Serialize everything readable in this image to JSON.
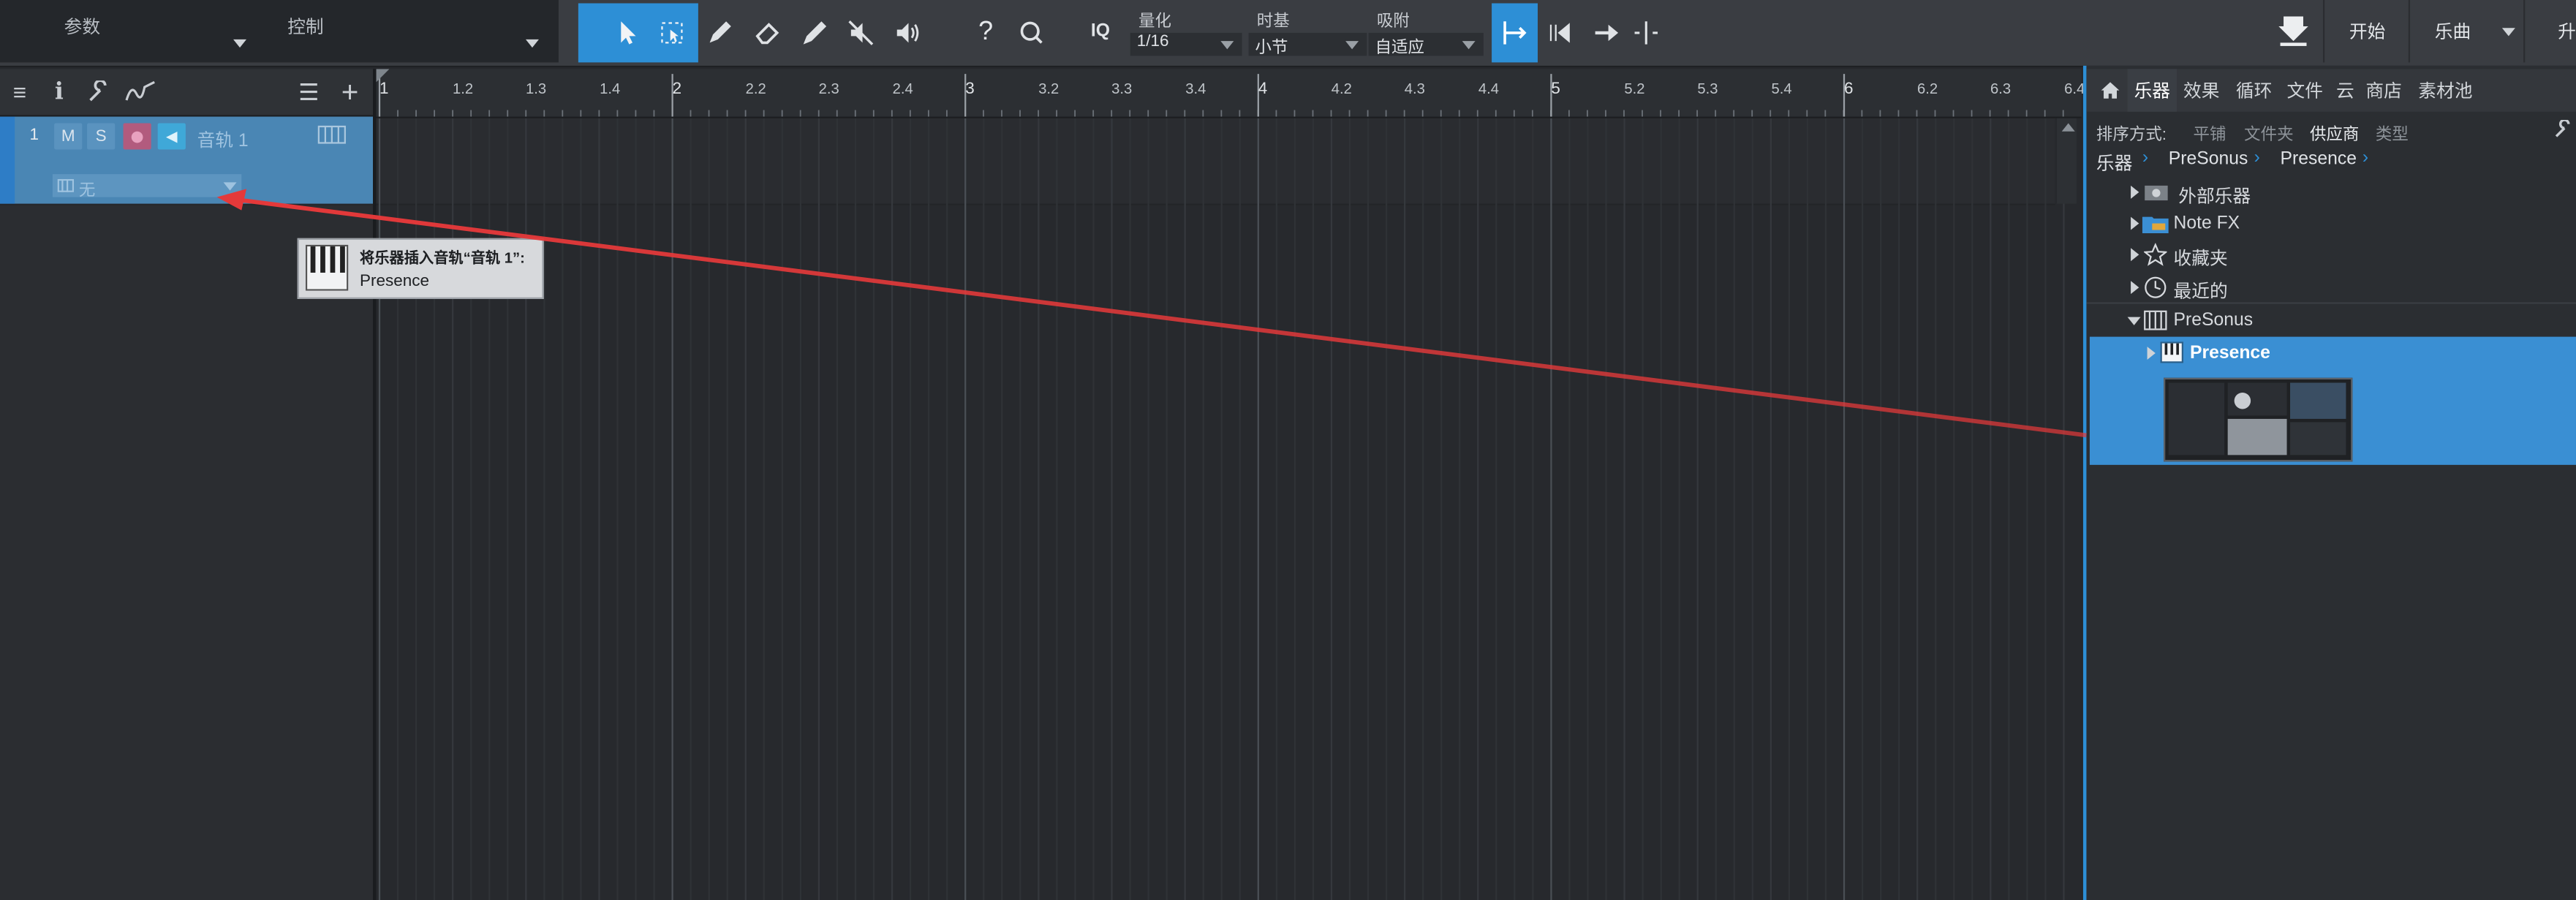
{
  "toolbar": {
    "params_label": "参数",
    "control_label": "控制",
    "iq_label": "IQ",
    "quantize": {
      "label": "量化",
      "value": "1/16"
    },
    "timebase": {
      "label": "时基",
      "value": "小节"
    },
    "snap": {
      "label": "吸附",
      "value": "自适应"
    },
    "help_glyph": "?",
    "right_buttons": [
      "开始",
      "乐曲",
      "升"
    ]
  },
  "track": {
    "number": "1",
    "mute": "M",
    "solo": "S",
    "name": "音轨 1",
    "instrument": "无"
  },
  "ruler": {
    "labels": [
      "1",
      "1.2",
      "1.3",
      "1.4",
      "2",
      "2.2",
      "2.3",
      "2.4",
      "3",
      "3.2",
      "3.3",
      "3.4",
      "4",
      "4.2",
      "4.3",
      "4.4",
      "5",
      "5.2",
      "5.3",
      "5.4",
      "6",
      "6.2",
      "6.3",
      "6.4"
    ]
  },
  "tooltip": {
    "line1": "将乐器插入音轨“音轨 1”:",
    "line2": "Presence"
  },
  "browser": {
    "tabs": [
      "乐器",
      "效果",
      "循环",
      "文件",
      "云",
      "商店",
      "素材池"
    ],
    "active_tab": "乐器",
    "sort_label": "排序方式:",
    "sort_options": [
      "平铺",
      "文件夹",
      "供应商",
      "类型"
    ],
    "active_sort": "供应商",
    "breadcrumb": [
      "乐器",
      "PreSonus",
      "Presence"
    ],
    "items": [
      {
        "label": "外部乐器",
        "icon": "plug-icon"
      },
      {
        "label": "Note FX",
        "icon": "folder-icon"
      },
      {
        "label": "收藏夹",
        "icon": "star-icon"
      },
      {
        "label": "最近的",
        "icon": "clock-icon"
      },
      {
        "label": "PreSonus",
        "icon": "vendor-icon"
      },
      {
        "label": "Presence",
        "icon": "keyboard-icon"
      }
    ]
  },
  "colors": {
    "accent": "#2d8fd6",
    "track_selected": "#4a86b4",
    "drag_arrow": "#e5393a"
  }
}
